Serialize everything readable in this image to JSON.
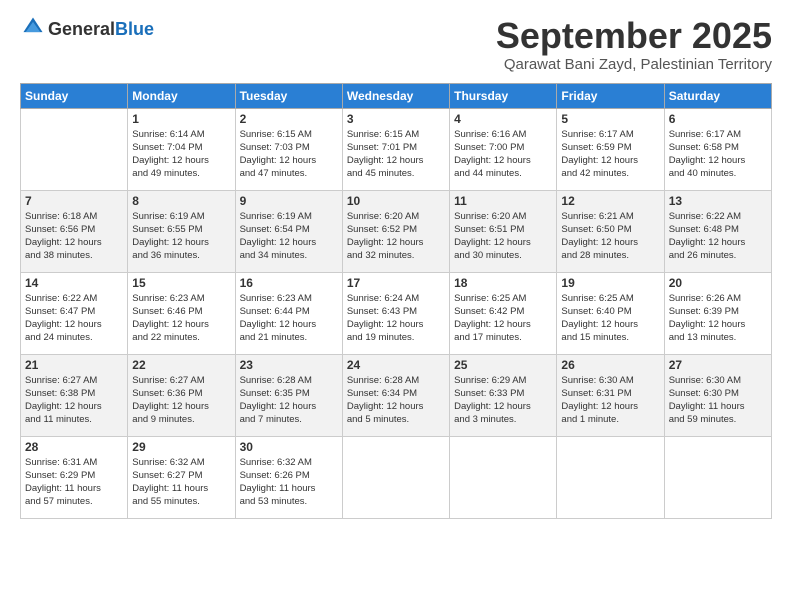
{
  "logo": {
    "general": "General",
    "blue": "Blue"
  },
  "header": {
    "month": "September 2025",
    "location": "Qarawat Bani Zayd, Palestinian Territory"
  },
  "weekdays": [
    "Sunday",
    "Monday",
    "Tuesday",
    "Wednesday",
    "Thursday",
    "Friday",
    "Saturday"
  ],
  "weeks": [
    [
      {
        "date": "",
        "info": ""
      },
      {
        "date": "1",
        "info": "Sunrise: 6:14 AM\nSunset: 7:04 PM\nDaylight: 12 hours\nand 49 minutes."
      },
      {
        "date": "2",
        "info": "Sunrise: 6:15 AM\nSunset: 7:03 PM\nDaylight: 12 hours\nand 47 minutes."
      },
      {
        "date": "3",
        "info": "Sunrise: 6:15 AM\nSunset: 7:01 PM\nDaylight: 12 hours\nand 45 minutes."
      },
      {
        "date": "4",
        "info": "Sunrise: 6:16 AM\nSunset: 7:00 PM\nDaylight: 12 hours\nand 44 minutes."
      },
      {
        "date": "5",
        "info": "Sunrise: 6:17 AM\nSunset: 6:59 PM\nDaylight: 12 hours\nand 42 minutes."
      },
      {
        "date": "6",
        "info": "Sunrise: 6:17 AM\nSunset: 6:58 PM\nDaylight: 12 hours\nand 40 minutes."
      }
    ],
    [
      {
        "date": "7",
        "info": "Sunrise: 6:18 AM\nSunset: 6:56 PM\nDaylight: 12 hours\nand 38 minutes."
      },
      {
        "date": "8",
        "info": "Sunrise: 6:19 AM\nSunset: 6:55 PM\nDaylight: 12 hours\nand 36 minutes."
      },
      {
        "date": "9",
        "info": "Sunrise: 6:19 AM\nSunset: 6:54 PM\nDaylight: 12 hours\nand 34 minutes."
      },
      {
        "date": "10",
        "info": "Sunrise: 6:20 AM\nSunset: 6:52 PM\nDaylight: 12 hours\nand 32 minutes."
      },
      {
        "date": "11",
        "info": "Sunrise: 6:20 AM\nSunset: 6:51 PM\nDaylight: 12 hours\nand 30 minutes."
      },
      {
        "date": "12",
        "info": "Sunrise: 6:21 AM\nSunset: 6:50 PM\nDaylight: 12 hours\nand 28 minutes."
      },
      {
        "date": "13",
        "info": "Sunrise: 6:22 AM\nSunset: 6:48 PM\nDaylight: 12 hours\nand 26 minutes."
      }
    ],
    [
      {
        "date": "14",
        "info": "Sunrise: 6:22 AM\nSunset: 6:47 PM\nDaylight: 12 hours\nand 24 minutes."
      },
      {
        "date": "15",
        "info": "Sunrise: 6:23 AM\nSunset: 6:46 PM\nDaylight: 12 hours\nand 22 minutes."
      },
      {
        "date": "16",
        "info": "Sunrise: 6:23 AM\nSunset: 6:44 PM\nDaylight: 12 hours\nand 21 minutes."
      },
      {
        "date": "17",
        "info": "Sunrise: 6:24 AM\nSunset: 6:43 PM\nDaylight: 12 hours\nand 19 minutes."
      },
      {
        "date": "18",
        "info": "Sunrise: 6:25 AM\nSunset: 6:42 PM\nDaylight: 12 hours\nand 17 minutes."
      },
      {
        "date": "19",
        "info": "Sunrise: 6:25 AM\nSunset: 6:40 PM\nDaylight: 12 hours\nand 15 minutes."
      },
      {
        "date": "20",
        "info": "Sunrise: 6:26 AM\nSunset: 6:39 PM\nDaylight: 12 hours\nand 13 minutes."
      }
    ],
    [
      {
        "date": "21",
        "info": "Sunrise: 6:27 AM\nSunset: 6:38 PM\nDaylight: 12 hours\nand 11 minutes."
      },
      {
        "date": "22",
        "info": "Sunrise: 6:27 AM\nSunset: 6:36 PM\nDaylight: 12 hours\nand 9 minutes."
      },
      {
        "date": "23",
        "info": "Sunrise: 6:28 AM\nSunset: 6:35 PM\nDaylight: 12 hours\nand 7 minutes."
      },
      {
        "date": "24",
        "info": "Sunrise: 6:28 AM\nSunset: 6:34 PM\nDaylight: 12 hours\nand 5 minutes."
      },
      {
        "date": "25",
        "info": "Sunrise: 6:29 AM\nSunset: 6:33 PM\nDaylight: 12 hours\nand 3 minutes."
      },
      {
        "date": "26",
        "info": "Sunrise: 6:30 AM\nSunset: 6:31 PM\nDaylight: 12 hours\nand 1 minute."
      },
      {
        "date": "27",
        "info": "Sunrise: 6:30 AM\nSunset: 6:30 PM\nDaylight: 11 hours\nand 59 minutes."
      }
    ],
    [
      {
        "date": "28",
        "info": "Sunrise: 6:31 AM\nSunset: 6:29 PM\nDaylight: 11 hours\nand 57 minutes."
      },
      {
        "date": "29",
        "info": "Sunrise: 6:32 AM\nSunset: 6:27 PM\nDaylight: 11 hours\nand 55 minutes."
      },
      {
        "date": "30",
        "info": "Sunrise: 6:32 AM\nSunset: 6:26 PM\nDaylight: 11 hours\nand 53 minutes."
      },
      {
        "date": "",
        "info": ""
      },
      {
        "date": "",
        "info": ""
      },
      {
        "date": "",
        "info": ""
      },
      {
        "date": "",
        "info": ""
      }
    ]
  ]
}
